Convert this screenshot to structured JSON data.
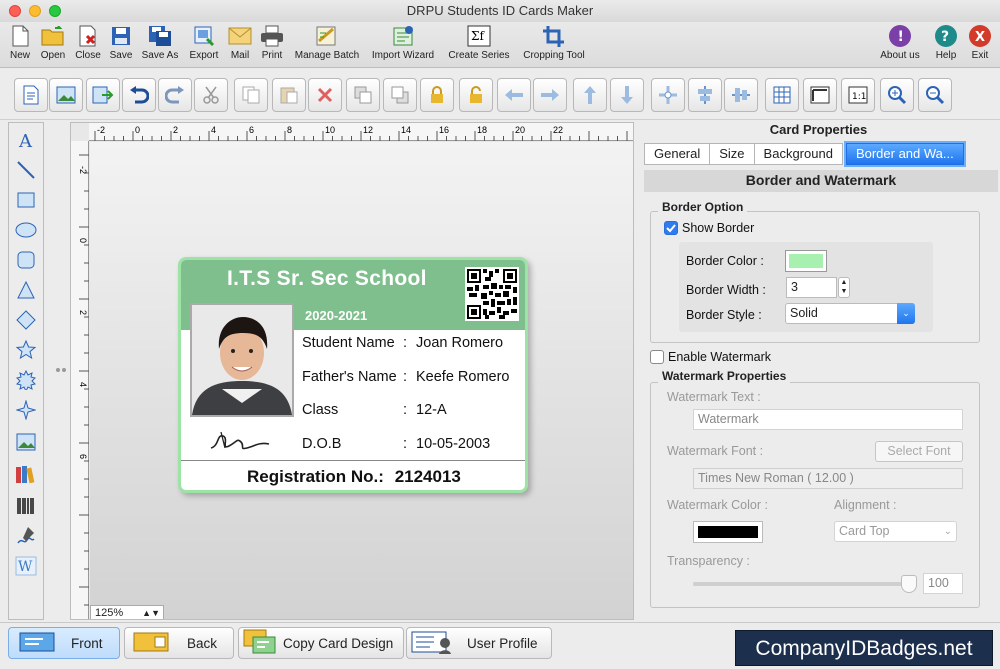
{
  "window": {
    "title": "DRPU Students ID Cards Maker"
  },
  "toolbar": {
    "buttons": [
      {
        "label": "New",
        "icon": "new-icon"
      },
      {
        "label": "Open",
        "icon": "open-icon"
      },
      {
        "label": "Close",
        "icon": "close-doc-icon"
      },
      {
        "label": "Save",
        "icon": "save-icon"
      },
      {
        "label": "Save As",
        "icon": "save-as-icon"
      },
      {
        "label": "Export",
        "icon": "export-icon"
      },
      {
        "label": "Mail",
        "icon": "mail-icon"
      },
      {
        "label": "Print",
        "icon": "print-icon"
      },
      {
        "label": "Manage Batch",
        "icon": "manage-batch-icon"
      },
      {
        "label": "Import Wizard",
        "icon": "import-wizard-icon"
      },
      {
        "label": "Create Series",
        "icon": "create-series-icon"
      },
      {
        "label": "Cropping Tool",
        "icon": "cropping-tool-icon"
      }
    ],
    "right_buttons": [
      {
        "label": "About us",
        "icon": "about-icon",
        "color": "#7b3fa8"
      },
      {
        "label": "Help",
        "icon": "help-icon",
        "color": "#1f8a8a"
      },
      {
        "label": "Exit",
        "icon": "exit-icon",
        "color": "#d23a2a"
      }
    ]
  },
  "ruler": {
    "top": [
      "-2",
      "0",
      "2",
      "4",
      "6",
      "8",
      "10",
      "12",
      "14",
      "16",
      "18",
      "20",
      "22"
    ],
    "left": [
      "-2",
      "0",
      "2",
      "4",
      "6"
    ]
  },
  "zoom": {
    "value": "125%"
  },
  "card": {
    "school": "I.T.S Sr. Sec School",
    "year": "2020-2021",
    "fields": [
      {
        "label": "Student Name",
        "sep": ":",
        "value": "Joan Romero"
      },
      {
        "label": "Father's Name",
        "sep": ":",
        "value": "Keefe Romero"
      },
      {
        "label": "Class",
        "sep": ":",
        "value": "12-A"
      },
      {
        "label": "D.O.B",
        "sep": ":",
        "value": "10-05-2003"
      }
    ],
    "registration_label": "Registration No.:",
    "registration_value": "2124013",
    "border_color": "#9ee3a6",
    "header_color": "#7fbf8e"
  },
  "props": {
    "title": "Card Properties",
    "tabs": [
      "General",
      "Size",
      "Background",
      "Border and Wa..."
    ],
    "active_tab": "Border and Wa...",
    "section_title": "Border and Watermark",
    "border_option": {
      "group_label": "Border Option",
      "show_border_label": "Show Border",
      "show_border_checked": true,
      "color_label": "Border Color :",
      "color_value": "#a8f0b0",
      "width_label": "Border Width :",
      "width_value": "3",
      "style_label": "Border Style :",
      "style_value": "Solid"
    },
    "enable_watermark_label": "Enable Watermark",
    "enable_watermark_checked": false,
    "watermark": {
      "group_label": "Watermark Properties",
      "text_label": "Watermark Text :",
      "text_value": "Watermark",
      "font_label": "Watermark Font :",
      "select_font_label": "Select Font",
      "font_value": "Times New Roman ( 12.00 )",
      "color_label": "Watermark Color :",
      "color_value": "#000000",
      "alignment_label": "Alignment :",
      "alignment_value": "Card Top",
      "transparency_label": "Transparency :",
      "transparency_value": "100"
    }
  },
  "bottom": {
    "front": "Front",
    "back": "Back",
    "copy": "Copy Card Design",
    "profile": "User Profile",
    "brand": "CompanyIDBadges.net"
  }
}
